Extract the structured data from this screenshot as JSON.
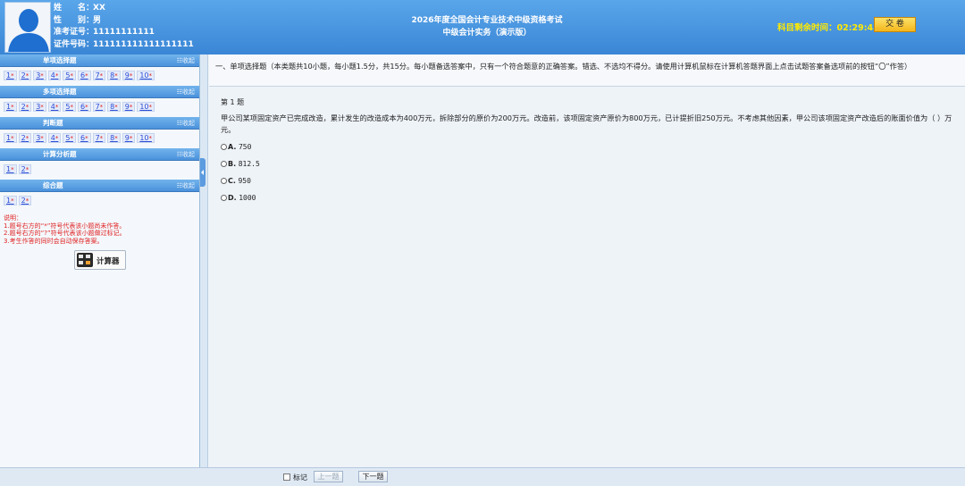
{
  "candidate": {
    "name_label": "姓　　名：",
    "name_value": "XX",
    "gender_label": "性　　别：",
    "gender_value": "男",
    "admission_label": "准考证号：",
    "admission_value": "11111111111",
    "id_label": "证件号码：",
    "id_value": "111111111111111111"
  },
  "header": {
    "exam_title": "2026年度全国会计专业技术中级资格考试",
    "subject": "中级会计实务（演示版）",
    "timer_label": "科目剩余时间：",
    "timer_value": "02:29:43",
    "submit_label": "交  卷"
  },
  "sidebar": {
    "collapse_label": "☷收起",
    "sections": [
      {
        "title": "单项选择题",
        "questions": [
          "1",
          "2",
          "3",
          "4",
          "5",
          "6",
          "7",
          "8",
          "9",
          "10"
        ]
      },
      {
        "title": "多项选择题",
        "questions": [
          "1",
          "2",
          "3",
          "4",
          "5",
          "6",
          "7",
          "8",
          "9",
          "10"
        ]
      },
      {
        "title": "判断题",
        "questions": [
          "1",
          "2",
          "3",
          "4",
          "5",
          "6",
          "7",
          "8",
          "9",
          "10"
        ]
      },
      {
        "title": "计算分析题",
        "questions": [
          "1",
          "2"
        ]
      },
      {
        "title": "综合题",
        "questions": [
          "1",
          "2"
        ]
      }
    ],
    "unanswered_mark": "*",
    "notes_title": "说明：",
    "notes": [
      "1.题号右方的“*”符号代表该小题尚未作答。",
      "2.题号右方的“?”符号代表该小题做过标记。",
      "3.考生作答的同时会自动保存答案。"
    ],
    "calculator_label": "计算器"
  },
  "main": {
    "instructions": "一、单项选择题（本类题共10小题，每小题1.5分，共15分。每小题备选答案中，只有一个符合题意的正确答案。错选、不选均不得分。请使用计算机鼠标在计算机答题界面上点击试题答案备选项前的按钮“〇”作答）",
    "question_number": "第 1 题",
    "question_stem": "甲公司某项固定资产已完成改造，累计发生的改造成本为400万元，拆除部分的原价为200万元。改造前，该项固定资产原价为800万元，已计提折旧250万元。不考虑其他因素，甲公司该项固定资产改造后的账面价值为（          ）万元。",
    "options": [
      {
        "letter": "A.",
        "value": "750"
      },
      {
        "letter": "B.",
        "value": "812.5"
      },
      {
        "letter": "C.",
        "value": "950"
      },
      {
        "letter": "D.",
        "value": "1000"
      }
    ]
  },
  "footer": {
    "mark_label": "标记",
    "prev_label": "上一题",
    "next_label": "下一题"
  },
  "colors": {
    "header_blue": "#3a86d6",
    "timer_yellow": "#ffea00",
    "note_red": "#e02222",
    "link_blue": "#2b4cd6"
  }
}
